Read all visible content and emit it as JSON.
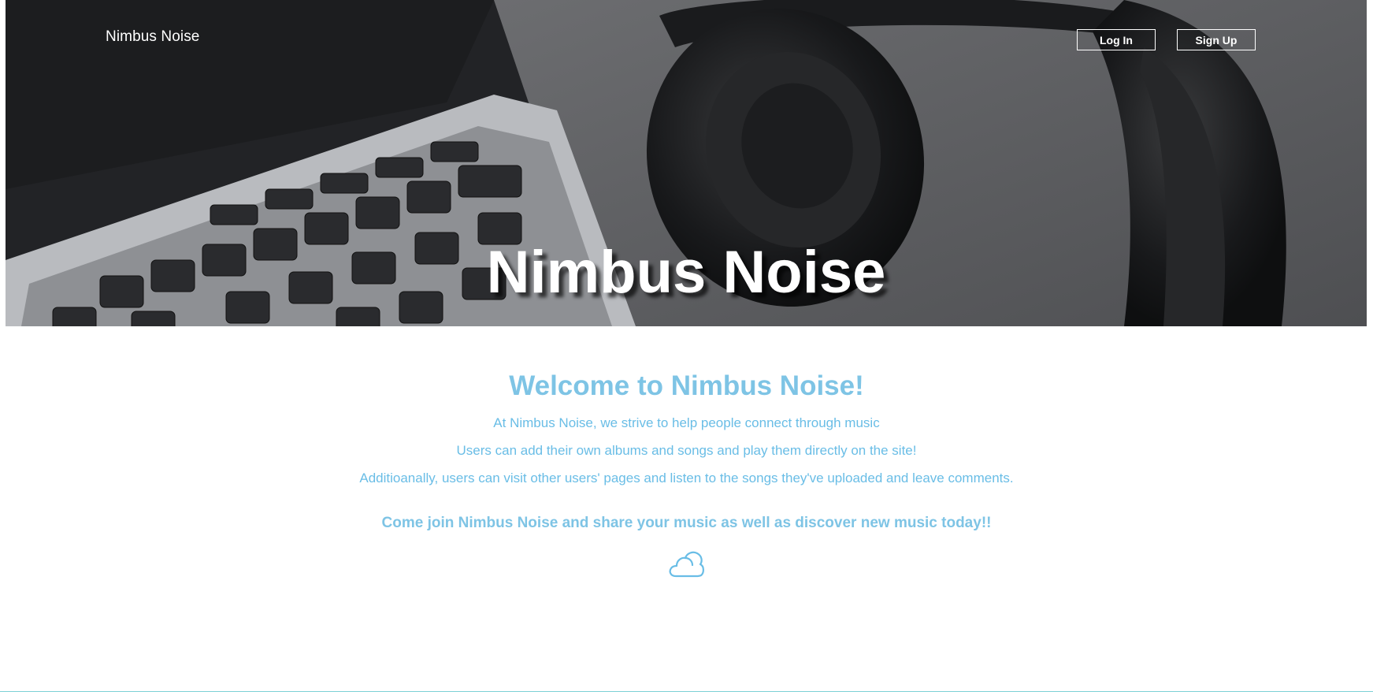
{
  "nav": {
    "brand": "Nimbus Noise",
    "login_label": "Log In",
    "signup_label": "Sign Up"
  },
  "hero": {
    "title": "Nimbus Noise",
    "image": "photo of laptop keyboard and headphones"
  },
  "main": {
    "heading": "Welcome to Nimbus Noise!",
    "paragraphs": [
      "At Nimbus Noise, we strive to help people connect through music",
      "Users can add their own albums and songs and play them directly on the site!",
      "Additioanally, users can visit other users' pages and listen to the songs they've uploaded and leave comments."
    ],
    "cta": "Come join Nimbus Noise and share your music as well as discover new music today!!",
    "icon": "cloud-icon"
  },
  "colors": {
    "accent": "#7ec4e5",
    "text_accent": "#69bde6",
    "rule": "#7dd0d6"
  }
}
